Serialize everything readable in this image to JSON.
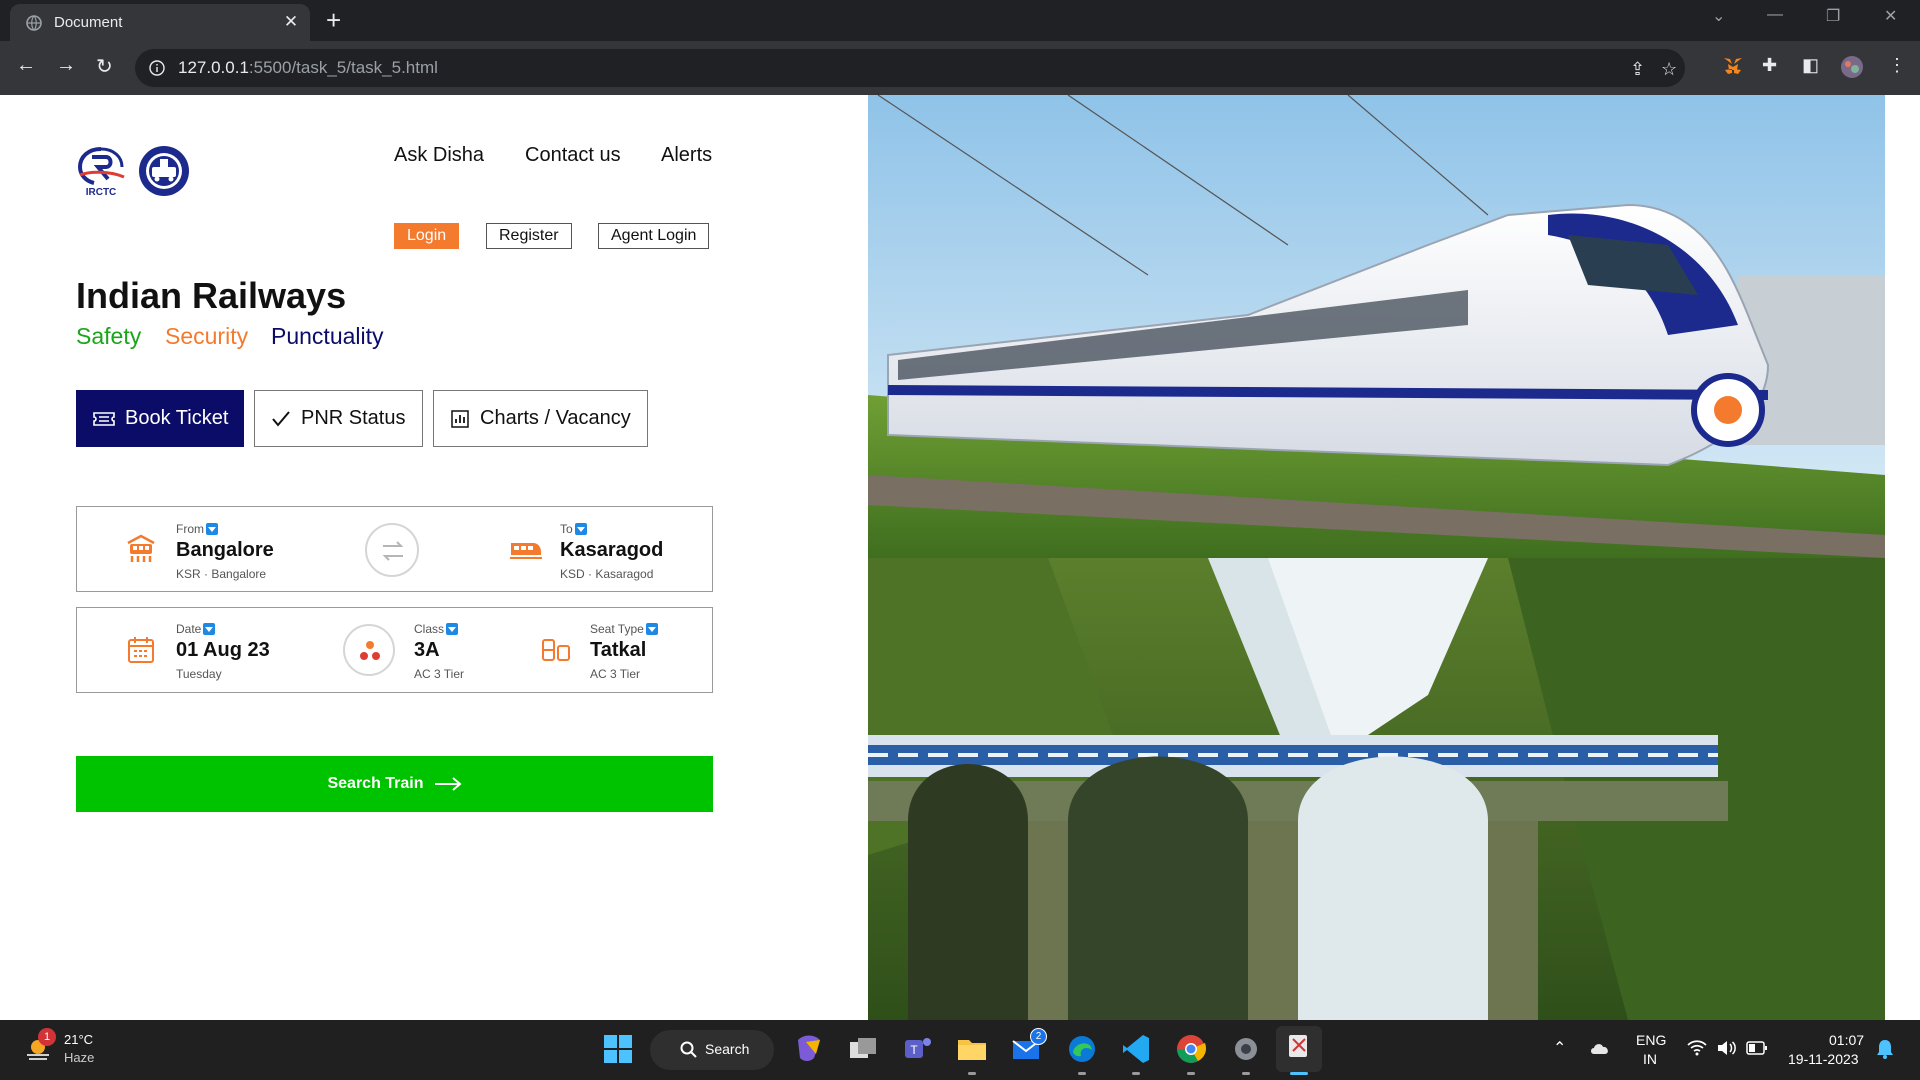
{
  "browser": {
    "tab_title": "Document",
    "tab_close": "✕",
    "new_tab": "+",
    "url_host": "127.0.0.1",
    "url_rest": ":5500/task_5/task_5.html"
  },
  "header": {
    "logo_irctc_text": "IRCTC",
    "links": [
      "Ask Disha",
      "Contact us",
      "Alerts"
    ],
    "buttons": [
      "Login",
      "Register",
      "Agent Login"
    ]
  },
  "hero_text": {
    "title": "Indian Railways",
    "motto": [
      {
        "text": "Safety",
        "color": "#1aa51a"
      },
      {
        "text": "Security",
        "color": "#f47a2e"
      },
      {
        "text": "Punctuality",
        "color": "#0b0c68"
      }
    ]
  },
  "modes": [
    {
      "label": "Book Ticket",
      "icon": "ticket-icon",
      "active": true
    },
    {
      "label": "PNR Status",
      "icon": "check-icon",
      "active": false
    },
    {
      "label": "Charts / Vacancy",
      "icon": "chart-icon",
      "active": false
    }
  ],
  "journey": {
    "from": {
      "label": "From",
      "value": "Bangalore",
      "sub": "KSR · Bangalore"
    },
    "to": {
      "label": "To",
      "value": "Kasaragod",
      "sub": "KSD · Kasaragod"
    },
    "date": {
      "label": "Date",
      "value": "01 Aug 23",
      "sub": "Tuesday"
    },
    "class": {
      "label": "Class",
      "value": "3A",
      "sub": "AC 3 Tier"
    },
    "seat": {
      "label": "Seat Type",
      "value": "Tatkal",
      "sub": "AC 3 Tier"
    }
  },
  "search_button": "Search Train",
  "colors": {
    "accent_orange": "#f47a2e",
    "navy": "#0b0c68",
    "green": "#00c300"
  },
  "taskbar": {
    "weather_temp": "21°C",
    "weather_desc": "Haze",
    "weather_badge": "1",
    "search_label": "Search",
    "mail_badge": "2",
    "lang_top": "ENG",
    "lang_bottom": "IN",
    "time": "01:07",
    "date": "19-11-2023"
  }
}
